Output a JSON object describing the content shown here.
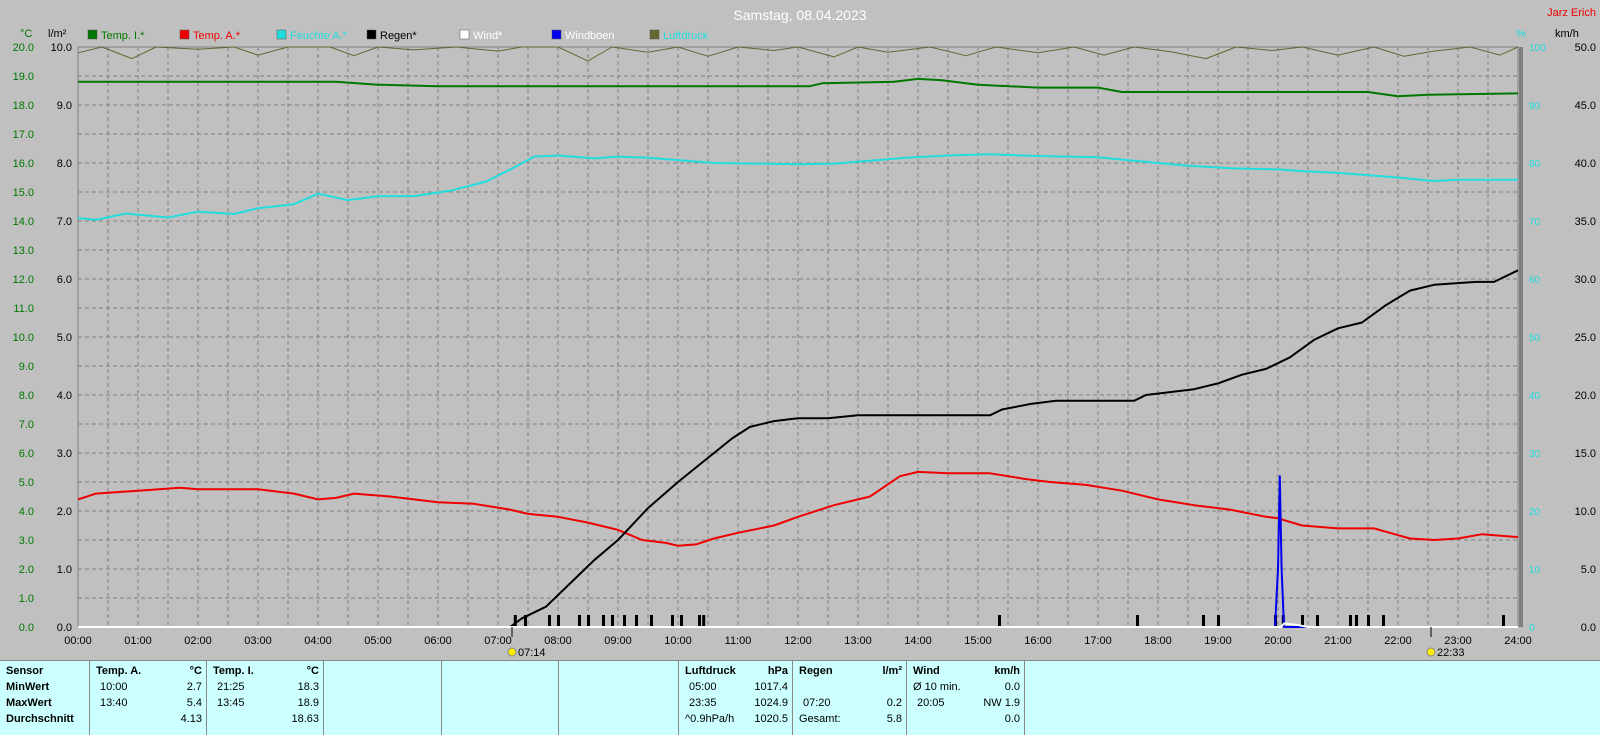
{
  "title": "Samstag, 08.04.2023",
  "author": "Jarz Erich",
  "colors": {
    "bg": "#c0c0c0",
    "grid": "#808080",
    "temp_i": "#007700",
    "temp_a": "#ee0000",
    "feuchte": "#22dddd",
    "regen": "#000000",
    "wind": "#ffffff",
    "boeen": "#0000ee",
    "luftdruck": "#666633"
  },
  "axis_units": {
    "left1": "°C",
    "left2": "l/m²",
    "right1": "%",
    "right2": "km/h"
  },
  "legend": [
    {
      "label": "Temp. I.*",
      "color": "#007700"
    },
    {
      "label": "Temp. A.*",
      "color": "#ee0000"
    },
    {
      "label": "Feuchte A.*",
      "color": "#22dddd"
    },
    {
      "label": "Regen*",
      "color": "#000000"
    },
    {
      "label": "Wind*",
      "color": "#ffffff"
    },
    {
      "label": "Windböen",
      "color": "#0000ee"
    },
    {
      "label": "Luftdruck",
      "color": "#666633"
    }
  ],
  "sun": {
    "rise": "07:14",
    "set": "22:33"
  },
  "chart_data": {
    "type": "line",
    "title": "Samstag, 08.04.2023",
    "x_ticks": [
      "00:00",
      "01:00",
      "02:00",
      "03:00",
      "04:00",
      "05:00",
      "06:00",
      "07:00",
      "08:00",
      "09:00",
      "10:00",
      "11:00",
      "12:00",
      "13:00",
      "14:00",
      "15:00",
      "16:00",
      "17:00",
      "18:00",
      "19:00",
      "20:00",
      "21:00",
      "22:00",
      "23:00",
      "24:00"
    ],
    "xlim": [
      0,
      24
    ],
    "y_left_temp_ticks": [
      "0.0",
      "1.0",
      "2.0",
      "3.0",
      "4.0",
      "5.0",
      "6.0",
      "7.0",
      "8.0",
      "9.0",
      "10.0",
      "11.0",
      "12.0",
      "13.0",
      "14.0",
      "15.0",
      "16.0",
      "17.0",
      "18.0",
      "19.0",
      "20.0"
    ],
    "y_left_temp_lim": [
      0,
      20
    ],
    "y_left_rain_ticks": [
      "0.0",
      "1.0",
      "2.0",
      "3.0",
      "4.0",
      "5.0",
      "6.0",
      "7.0",
      "8.0",
      "9.0",
      "10.0"
    ],
    "y_left_rain_lim": [
      0,
      10
    ],
    "y_right_hum_ticks": [
      "0",
      "10",
      "20",
      "30",
      "40",
      "50",
      "60",
      "70",
      "80",
      "90",
      "100"
    ],
    "y_right_hum_lim": [
      0,
      100
    ],
    "y_right_wind_ticks": [
      "0.0",
      "5.0",
      "10.0",
      "15.0",
      "20.0",
      "25.0",
      "30.0",
      "35.0",
      "40.0",
      "45.0",
      "50.0"
    ],
    "y_right_wind_lim": [
      0,
      50
    ],
    "series": [
      {
        "name": "Temp. I.*",
        "axis": "temp",
        "color": "#007700",
        "points": [
          [
            0,
            18.8
          ],
          [
            4.3,
            18.8
          ],
          [
            5,
            18.7
          ],
          [
            6,
            18.65
          ],
          [
            12.2,
            18.65
          ],
          [
            12.4,
            18.75
          ],
          [
            13.6,
            18.8
          ],
          [
            14,
            18.9
          ],
          [
            14.4,
            18.85
          ],
          [
            15,
            18.7
          ],
          [
            16,
            18.6
          ],
          [
            17,
            18.6
          ],
          [
            17.4,
            18.45
          ],
          [
            18,
            18.45
          ],
          [
            21.5,
            18.45
          ],
          [
            22,
            18.3
          ],
          [
            22.5,
            18.35
          ],
          [
            24,
            18.4
          ]
        ]
      },
      {
        "name": "Temp. A.*",
        "axis": "temp",
        "color": "#ee0000",
        "points": [
          [
            0,
            4.4
          ],
          [
            0.3,
            4.6
          ],
          [
            1,
            4.7
          ],
          [
            1.7,
            4.8
          ],
          [
            2,
            4.75
          ],
          [
            3,
            4.75
          ],
          [
            3.6,
            4.6
          ],
          [
            4,
            4.4
          ],
          [
            4.3,
            4.45
          ],
          [
            4.6,
            4.6
          ],
          [
            5.2,
            4.5
          ],
          [
            6,
            4.3
          ],
          [
            6.6,
            4.25
          ],
          [
            7.2,
            4.05
          ],
          [
            7.5,
            3.9
          ],
          [
            8,
            3.8
          ],
          [
            8.5,
            3.6
          ],
          [
            9,
            3.35
          ],
          [
            9.4,
            3.0
          ],
          [
            9.8,
            2.9
          ],
          [
            10,
            2.8
          ],
          [
            10.3,
            2.85
          ],
          [
            10.6,
            3.05
          ],
          [
            11,
            3.25
          ],
          [
            11.6,
            3.5
          ],
          [
            12,
            3.8
          ],
          [
            12.6,
            4.2
          ],
          [
            13.2,
            4.5
          ],
          [
            13.7,
            5.2
          ],
          [
            14,
            5.35
          ],
          [
            14.5,
            5.3
          ],
          [
            15.2,
            5.3
          ],
          [
            15.8,
            5.1
          ],
          [
            16.2,
            5.0
          ],
          [
            16.8,
            4.9
          ],
          [
            17.4,
            4.7
          ],
          [
            18,
            4.4
          ],
          [
            18.6,
            4.2
          ],
          [
            19.2,
            4.05
          ],
          [
            19.8,
            3.8
          ],
          [
            20,
            3.75
          ],
          [
            20.4,
            3.5
          ],
          [
            21,
            3.4
          ],
          [
            21.6,
            3.4
          ],
          [
            22.2,
            3.05
          ],
          [
            22.6,
            3.0
          ],
          [
            23,
            3.05
          ],
          [
            23.4,
            3.2
          ],
          [
            24,
            3.1
          ]
        ]
      },
      {
        "name": "Feuchte A.*",
        "axis": "hum",
        "color": "#22dddd",
        "points": [
          [
            0,
            70.5
          ],
          [
            0.3,
            70.2
          ],
          [
            0.8,
            71.3
          ],
          [
            1.5,
            70.6
          ],
          [
            2,
            71.6
          ],
          [
            2.6,
            71.2
          ],
          [
            3,
            72.2
          ],
          [
            3.6,
            72.9
          ],
          [
            4,
            74.7
          ],
          [
            4.5,
            73.6
          ],
          [
            5,
            74.3
          ],
          [
            5.6,
            74.3
          ],
          [
            6.2,
            75.2
          ],
          [
            6.8,
            76.8
          ],
          [
            7.3,
            79.4
          ],
          [
            7.6,
            81.1
          ],
          [
            8,
            81.3
          ],
          [
            8.6,
            80.8
          ],
          [
            9,
            81.1
          ],
          [
            9.5,
            80.9
          ],
          [
            10,
            80.5
          ],
          [
            10.6,
            80.0
          ],
          [
            11.3,
            79.9
          ],
          [
            12,
            79.8
          ],
          [
            12.6,
            79.9
          ],
          [
            13.2,
            80.4
          ],
          [
            13.8,
            80.9
          ],
          [
            14.5,
            81.3
          ],
          [
            15.2,
            81.5
          ],
          [
            16,
            81.2
          ],
          [
            17,
            81.0
          ],
          [
            17.6,
            80.4
          ],
          [
            18.4,
            79.6
          ],
          [
            19.2,
            79.1
          ],
          [
            20,
            78.9
          ],
          [
            20.4,
            78.6
          ],
          [
            21,
            78.3
          ],
          [
            22,
            77.5
          ],
          [
            22.6,
            76.9
          ],
          [
            23,
            77.1
          ],
          [
            24,
            77.1
          ]
        ]
      },
      {
        "name": "Regen*",
        "axis": "rain",
        "color": "#000000",
        "points": [
          [
            0,
            0
          ],
          [
            7.2,
            0
          ],
          [
            7.4,
            0.15
          ],
          [
            7.8,
            0.35
          ],
          [
            8.2,
            0.75
          ],
          [
            8.6,
            1.15
          ],
          [
            9,
            1.5
          ],
          [
            9.5,
            2.05
          ],
          [
            10,
            2.5
          ],
          [
            10.3,
            2.75
          ],
          [
            10.6,
            3.0
          ],
          [
            10.9,
            3.25
          ],
          [
            11.2,
            3.45
          ],
          [
            11.6,
            3.55
          ],
          [
            12,
            3.6
          ],
          [
            12.5,
            3.6
          ],
          [
            13,
            3.65
          ],
          [
            14,
            3.65
          ],
          [
            15.2,
            3.65
          ],
          [
            15.4,
            3.75
          ],
          [
            15.9,
            3.85
          ],
          [
            16.3,
            3.9
          ],
          [
            17.6,
            3.9
          ],
          [
            17.8,
            4.0
          ],
          [
            18.2,
            4.05
          ],
          [
            18.6,
            4.1
          ],
          [
            19,
            4.2
          ],
          [
            19.4,
            4.35
          ],
          [
            19.8,
            4.45
          ],
          [
            20.2,
            4.65
          ],
          [
            20.6,
            4.95
          ],
          [
            21,
            5.15
          ],
          [
            21.4,
            5.25
          ],
          [
            21.8,
            5.55
          ],
          [
            22.2,
            5.8
          ],
          [
            22.6,
            5.9
          ],
          [
            23.3,
            5.95
          ],
          [
            23.6,
            5.95
          ],
          [
            24,
            6.15
          ]
        ]
      },
      {
        "name": "Windböen",
        "axis": "wind",
        "color": "#0000ee",
        "points": [
          [
            0,
            0
          ],
          [
            19.95,
            0
          ],
          [
            20.0,
            5.0
          ],
          [
            20.03,
            13.0
          ],
          [
            20.06,
            5.0
          ],
          [
            20.1,
            0
          ],
          [
            24,
            0
          ]
        ]
      },
      {
        "name": "Wind*",
        "axis": "wind",
        "color": "#ffffff",
        "points": [
          [
            0,
            0
          ],
          [
            20.05,
            0
          ],
          [
            20.1,
            0.3
          ],
          [
            20.3,
            0.2
          ],
          [
            20.5,
            0
          ],
          [
            24,
            0
          ]
        ]
      },
      {
        "name": "Luftdruck",
        "axis": "top",
        "color": "#666633",
        "points": [
          [
            0,
            99.0
          ],
          [
            0.4,
            100
          ],
          [
            0.9,
            98.0
          ],
          [
            1.3,
            100
          ],
          [
            2,
            99.6
          ],
          [
            2.6,
            100
          ],
          [
            3,
            98.6
          ],
          [
            3.5,
            100
          ],
          [
            4.2,
            100
          ],
          [
            4.6,
            98.5
          ],
          [
            5,
            100
          ],
          [
            5.6,
            99.5
          ],
          [
            6.3,
            100
          ],
          [
            7,
            99.3
          ],
          [
            7.4,
            100
          ],
          [
            8,
            100
          ],
          [
            8.5,
            97.6
          ],
          [
            8.9,
            100
          ],
          [
            9.5,
            99.1
          ],
          [
            10,
            100
          ],
          [
            10.5,
            98.4
          ],
          [
            11,
            100
          ],
          [
            11.6,
            99.4
          ],
          [
            12,
            100
          ],
          [
            12.6,
            98.3
          ],
          [
            13,
            100
          ],
          [
            13.5,
            99.1
          ],
          [
            14.2,
            100
          ],
          [
            14.8,
            98.5
          ],
          [
            15.3,
            100
          ],
          [
            16,
            99.0
          ],
          [
            16.6,
            100
          ],
          [
            17.1,
            98.6
          ],
          [
            17.6,
            100
          ],
          [
            18.2,
            99.2
          ],
          [
            18.8,
            98.0
          ],
          [
            19.3,
            100
          ],
          [
            19.9,
            99.4
          ],
          [
            20.4,
            100
          ],
          [
            21,
            98.6
          ],
          [
            21.6,
            100
          ],
          [
            22.1,
            98.4
          ],
          [
            22.6,
            99.3
          ],
          [
            23.2,
            100
          ],
          [
            23.7,
            98.6
          ],
          [
            24,
            100
          ]
        ]
      }
    ],
    "rain_ticks_hours": [
      7.28,
      7.45,
      7.85,
      8.0,
      8.35,
      8.5,
      8.75,
      8.9,
      9.1,
      9.3,
      9.55,
      9.9,
      10.05,
      10.35,
      10.42,
      15.35,
      17.65,
      18.75,
      19.0,
      19.95,
      20.08,
      20.4,
      20.65,
      21.2,
      21.3,
      21.5,
      21.75,
      23.75
    ]
  },
  "stats": {
    "sensor": {
      "header": "Sensor",
      "rows": [
        "MinWert",
        "MaxWert",
        "Durchschnitt"
      ]
    },
    "temp_a": {
      "header": "Temp. A.",
      "unit": "°C",
      "min_time": "10:00",
      "min": "2.7",
      "max_time": "13:40",
      "max": "5.4",
      "avg": "4.13"
    },
    "temp_i": {
      "header": "Temp. I.",
      "unit": "°C",
      "min_time": "21:25",
      "min": "18.3",
      "max_time": "13:45",
      "max": "18.9",
      "avg": "18.63"
    },
    "luftdruck": {
      "header": "Luftdruck",
      "unit": "hPa",
      "min_time": "05:00",
      "min": "1017.4",
      "max_time": "23:35",
      "max": "1024.9",
      "trend_label": "^0.9hPa/h",
      "trend_value": "1020.5"
    },
    "regen": {
      "header": "Regen",
      "unit": "l/m²",
      "max_time": "07:20",
      "max": "0.2",
      "total_label": "Gesamt:",
      "total": "5.8"
    },
    "wind": {
      "header": "Wind",
      "unit": "km/h",
      "min_label": "Ø 10 min.",
      "min": "0.0",
      "max_time": "20:05",
      "max": "NW 1.9",
      "avg": "0.0"
    }
  }
}
